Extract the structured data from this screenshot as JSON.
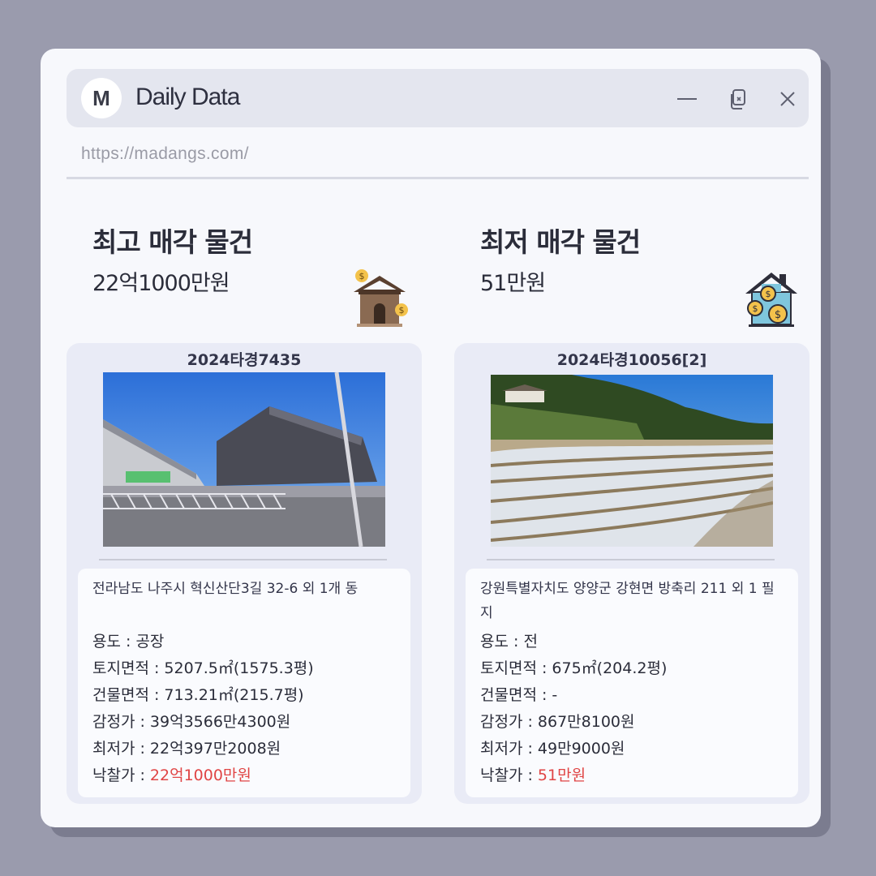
{
  "app": {
    "logo_letter": "M",
    "title": "Daily Data",
    "url": "https://madangs.com/"
  },
  "left": {
    "heading": "최고 매각 물건",
    "price": "22억1000만원",
    "case_no": "2024타경7435",
    "address": "전라남도 나주시 혁신산단3길 32-6 외 1개 동",
    "usage_label": "용도 : ",
    "usage": "공장",
    "land_label": "토지면적 : ",
    "land": "5207.5㎡(1575.3평)",
    "building_label": "건물면적 : ",
    "building": "713.21㎡(215.7평)",
    "appraisal_label": "감정가 : ",
    "appraisal": "39억3566만4300원",
    "minimum_label": "최저가 : ",
    "minimum": "22억397만2008원",
    "winning_label": "낙찰가 : ",
    "winning": "22억1000만원"
  },
  "right": {
    "heading": "최저 매각 물건",
    "price": "51만원",
    "case_no": "2024타경10056[2]",
    "address": "강원특별자치도 양양군 강현면 방축리 211 외 1 필지",
    "usage_label": "용도 : ",
    "usage": "전",
    "land_label": "토지면적 : ",
    "land": "675㎡(204.2평)",
    "building_label": "건물면적 : ",
    "building": "-",
    "appraisal_label": "감정가 : ",
    "appraisal": "867만8100원",
    "minimum_label": "최저가 : ",
    "minimum": "49만9000원",
    "winning_label": "낙찰가 : ",
    "winning": "51만원"
  },
  "colors": {
    "accent_red": "#e04545",
    "window_bg": "#f7f8fc",
    "card_bg": "#e9ebf6"
  }
}
